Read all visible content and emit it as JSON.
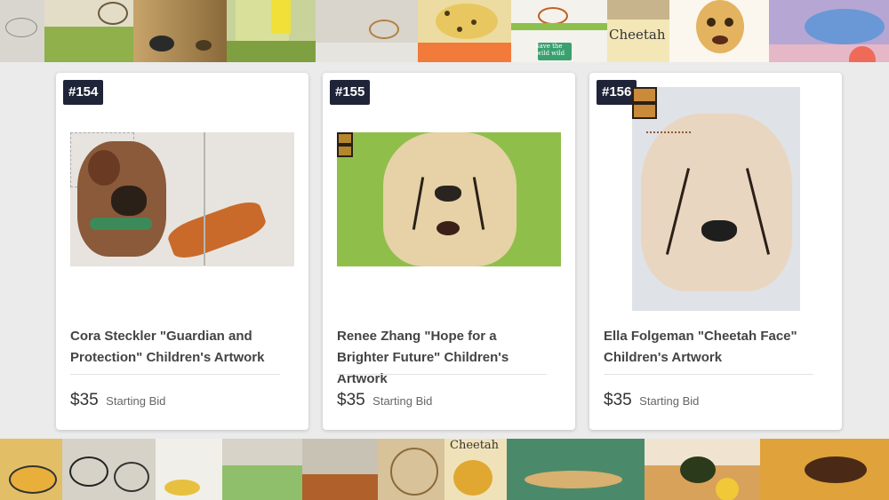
{
  "collage_top": {
    "tiles": [
      "#d9d6cf",
      "#bcb8a6",
      "#cfcdc6",
      "#e2d8bc",
      "#c9d3a0",
      "#d7d0c6",
      "#efe6c4",
      "#e9e7df",
      "#c8b48c",
      "#fbf7ee",
      "#b6a6d4"
    ],
    "cheetah_text": "Cheetah",
    "save_text": "save the wild wild"
  },
  "collage_bottom": {
    "tiles": [
      "#cfa55a",
      "#d6d2c8",
      "#c7c2b6",
      "#b8b4a8",
      "#d8c29a",
      "#c5a060",
      "#6a9a72",
      "#cfc8bb",
      "#d9a25a",
      "#e0a23a"
    ],
    "cheetah_text": "Cheetah"
  },
  "lots": [
    {
      "lot": "#154",
      "title": "Cora Steckler \"Guardian and Protection\" Children's Artwork",
      "price": "$35",
      "bid_label": "Starting Bid",
      "art": "mixed-media-dog-and-cheetah"
    },
    {
      "lot": "#155",
      "title": "Renee Zhang \"Hope for a Brighter Future\" Children's Artwork",
      "price": "$35",
      "bid_label": "Starting Bid",
      "art": "painted-cheetah-portrait"
    },
    {
      "lot": "#156",
      "title": "Ella Folgeman \"Cheetah Face\" Children's Artwork",
      "price": "$35",
      "bid_label": "Starting Bid",
      "art": "watercolor-cheetah-face"
    }
  ]
}
